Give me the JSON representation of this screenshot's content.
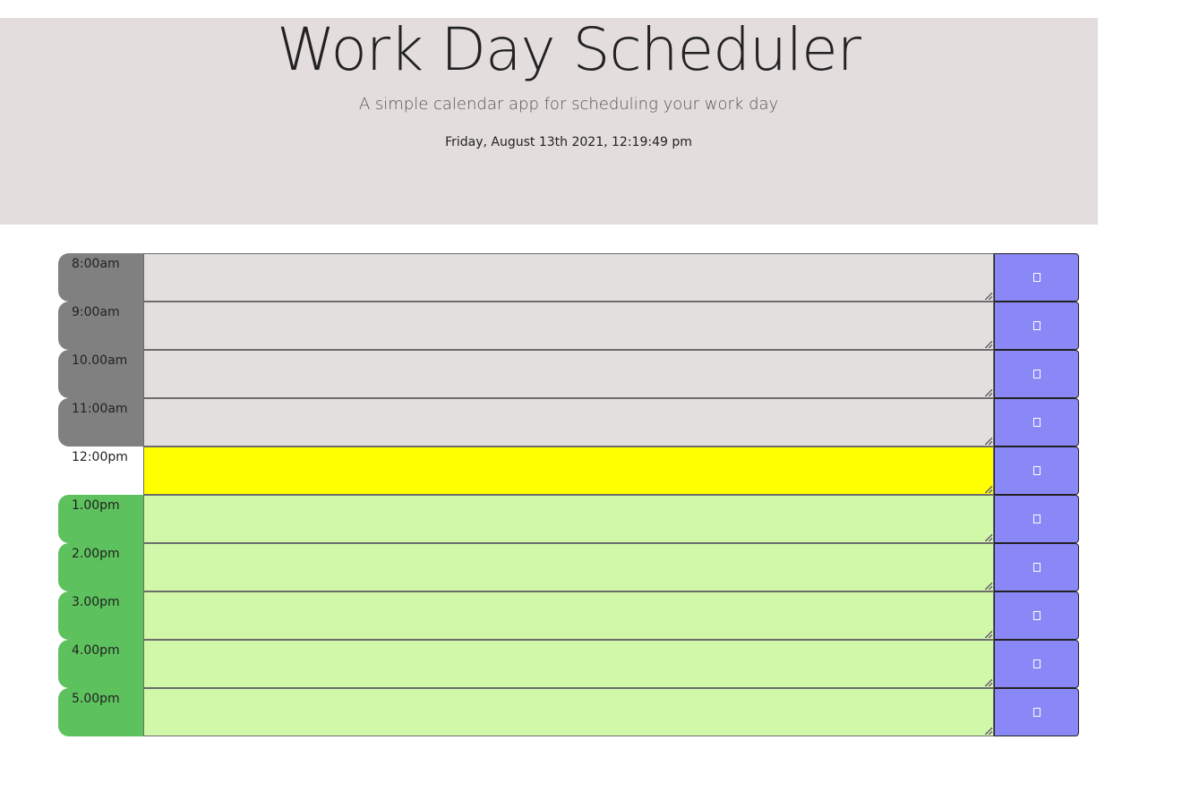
{
  "header": {
    "title": "Work Day Scheduler",
    "subtitle": "A simple calendar app for scheduling your work day",
    "current_day": "Friday, August 13th 2021, 12:19:49 pm"
  },
  "colors": {
    "header_bg": "#e4dddd",
    "past": "#808080",
    "past_textarea": "#e4dfdf",
    "present": "#ffff00",
    "future": "#5dc15d",
    "future_textarea": "#d1f7a8",
    "save_button": "#8a88f6"
  },
  "rows": [
    {
      "hour": "8:00am",
      "status": "past",
      "text": "",
      "save_icon": "save-icon"
    },
    {
      "hour": "9:00am",
      "status": "past",
      "text": "",
      "save_icon": "save-icon"
    },
    {
      "hour": "10.00am",
      "status": "past",
      "text": "",
      "save_icon": "save-icon"
    },
    {
      "hour": "11:00am",
      "status": "past",
      "text": "",
      "save_icon": "save-icon"
    },
    {
      "hour": "12:00pm",
      "status": "present",
      "text": "",
      "save_icon": "save-icon"
    },
    {
      "hour": "1.00pm",
      "status": "future",
      "text": "",
      "save_icon": "save-icon"
    },
    {
      "hour": "2.00pm",
      "status": "future",
      "text": "",
      "save_icon": "save-icon"
    },
    {
      "hour": "3.00pm",
      "status": "future",
      "text": "",
      "save_icon": "save-icon"
    },
    {
      "hour": "4.00pm",
      "status": "future",
      "text": "",
      "save_icon": "save-icon"
    },
    {
      "hour": "5.00pm",
      "status": "future",
      "text": "",
      "save_icon": "save-icon"
    }
  ]
}
